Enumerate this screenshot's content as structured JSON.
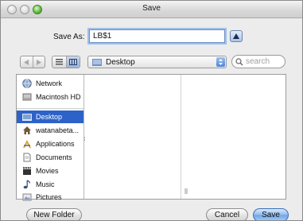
{
  "window": {
    "title": "Save"
  },
  "save_as": {
    "label": "Save As:",
    "value": "LB$1"
  },
  "toolbar": {
    "location": "Desktop",
    "search_placeholder": "search"
  },
  "sidebar": {
    "items": [
      {
        "label": "Network",
        "icon": "network-icon"
      },
      {
        "label": "Macintosh HD",
        "icon": "hard-drive-icon"
      },
      {
        "label": "Desktop",
        "icon": "desktop-icon",
        "selected": true
      },
      {
        "label": "watanabeta...",
        "icon": "home-icon"
      },
      {
        "label": "Applications",
        "icon": "applications-icon"
      },
      {
        "label": "Documents",
        "icon": "documents-icon"
      },
      {
        "label": "Movies",
        "icon": "movies-icon"
      },
      {
        "label": "Music",
        "icon": "music-icon"
      },
      {
        "label": "Pictures",
        "icon": "pictures-icon"
      }
    ]
  },
  "buttons": {
    "new_folder": "New Folder",
    "cancel": "Cancel",
    "save": "Save"
  },
  "colors": {
    "selection": "#2d63c8",
    "default_button": "#6fa3e8"
  }
}
